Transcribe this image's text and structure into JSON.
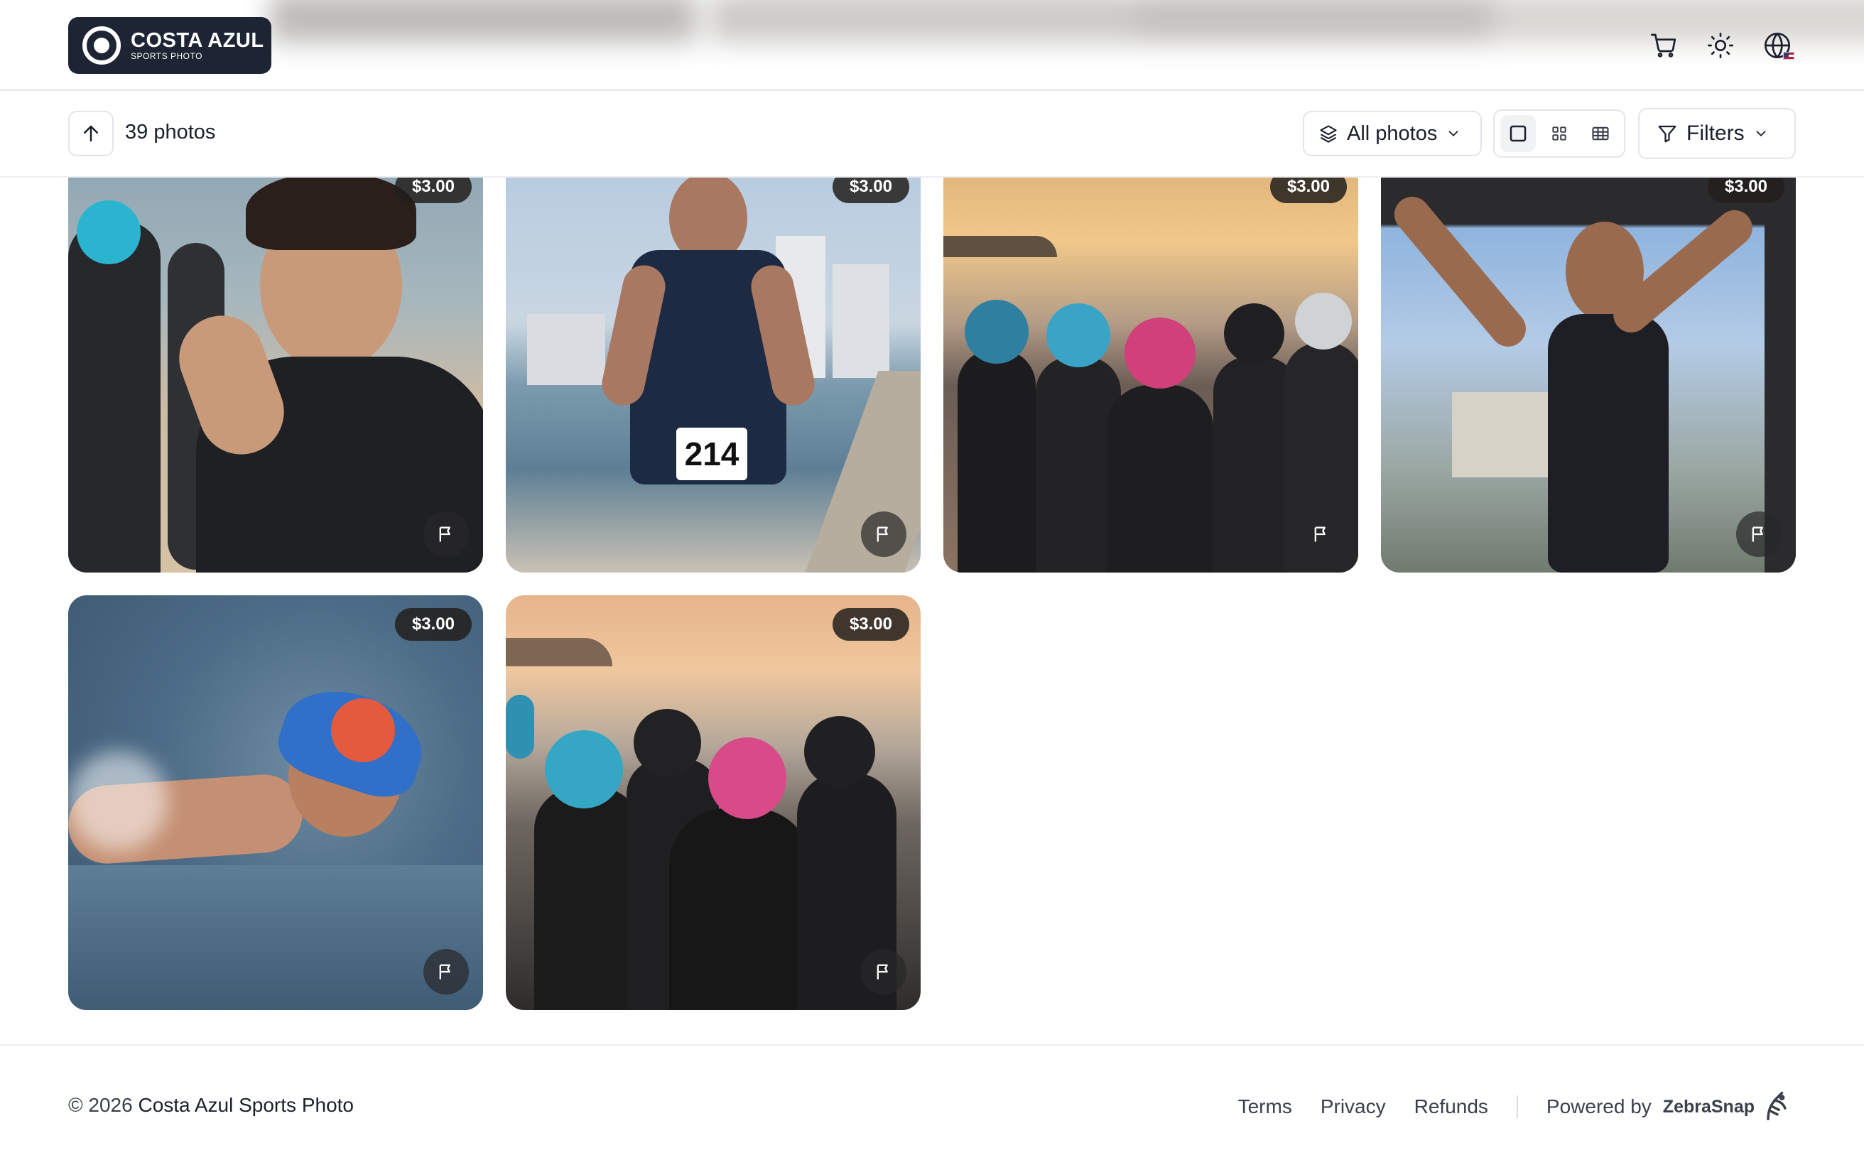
{
  "header": {
    "logo_title": "COSTA AZUL",
    "logo_subtitle": "SPORTS PHOTO",
    "icons": [
      "cart-icon",
      "sun-icon",
      "globe-icon"
    ],
    "language_flag": "us-flag"
  },
  "toolbar": {
    "photo_count": "39 photos",
    "album_select": "All photos",
    "view_modes": [
      "large-grid",
      "small-grid",
      "list"
    ],
    "active_view": "large-grid",
    "filters_label": "Filters"
  },
  "photos": [
    {
      "price": "$3.00",
      "subject": "woman adjusting goggles on beach"
    },
    {
      "price": "$3.00",
      "subject": "runner with bib number 214",
      "bib": "214"
    },
    {
      "price": "$3.00",
      "subject": "swimmers walking to sea at sunset"
    },
    {
      "price": "$3.00",
      "subject": "athlete crossing finish line"
    },
    {
      "price": "$3.00",
      "subject": "swimmer in open water"
    },
    {
      "price": "$3.00",
      "subject": "swimmers in caps facing sea"
    }
  ],
  "footer": {
    "copyright_prefix": "© 2026",
    "brand": "Costa Azul Sports Photo",
    "links": [
      "Terms",
      "Privacy",
      "Refunds"
    ],
    "powered_by": "Powered by",
    "powered_brand": "ZebraSnap"
  },
  "colors": {
    "logo_bg": "#1d2433",
    "price_badge": "#221e1c",
    "border": "#e3e5ea"
  }
}
